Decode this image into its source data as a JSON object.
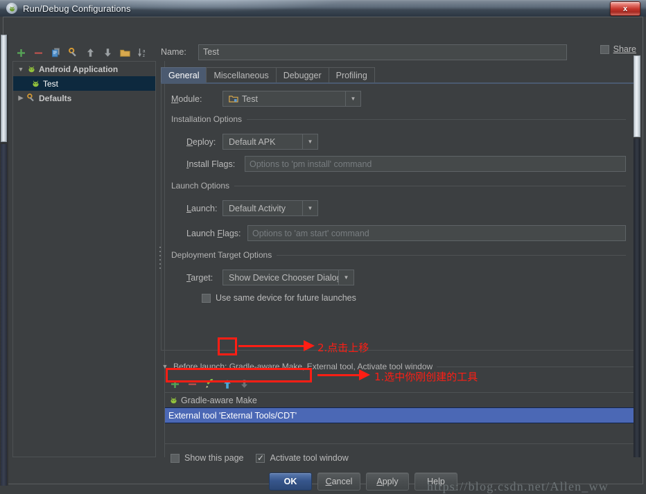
{
  "window": {
    "title": "Run/Debug Configurations",
    "icon": "android-studio-icon",
    "close_label": "x"
  },
  "sidebar": {
    "toolbar": [
      {
        "name": "add-configuration-button",
        "glyph": "+"
      },
      {
        "name": "remove-configuration-button",
        "glyph": "−"
      },
      {
        "name": "copy-configuration-button",
        "glyph": "copy-icon"
      },
      {
        "name": "edit-defaults-button",
        "glyph": "wrench-icon"
      },
      {
        "name": "move-up-button",
        "glyph": "↑"
      },
      {
        "name": "move-down-button",
        "glyph": "↓"
      },
      {
        "name": "create-folder-button",
        "glyph": "folder-icon"
      },
      {
        "name": "sort-configurations-button",
        "glyph": "sort-az-icon"
      }
    ],
    "tree": [
      {
        "label": "Android Application",
        "level": 0,
        "expanded": true,
        "icon": "android-icon",
        "selected": false,
        "bold": true
      },
      {
        "label": "Test",
        "level": 1,
        "expanded": null,
        "icon": "android-icon",
        "selected": true,
        "bold": false
      },
      {
        "label": "Defaults",
        "level": 0,
        "expanded": false,
        "icon": "wrench-icon",
        "selected": false,
        "bold": true
      }
    ]
  },
  "form": {
    "name_label": "Name:",
    "name_value": "Test",
    "share_label": "Share",
    "share_checked": false,
    "tabs": [
      {
        "label": "General",
        "active": true
      },
      {
        "label": "Miscellaneous",
        "active": false
      },
      {
        "label": "Debugger",
        "active": false
      },
      {
        "label": "Profiling",
        "active": false
      }
    ],
    "module_label": "Module:",
    "module_value": "Test",
    "installation_options_label": "Installation Options",
    "deploy_label": "Deploy:",
    "deploy_value": "Default APK",
    "install_flags_label": "Install Flags:",
    "install_flags_placeholder": "Options to 'pm install' command",
    "install_flags_value": "",
    "launch_options_label": "Launch Options",
    "launch_label": "Launch:",
    "launch_value": "Default Activity",
    "launch_flags_label": "Launch Flags:",
    "launch_flags_placeholder": "Options to 'am start' command",
    "launch_flags_value": "",
    "deployment_target_label": "Deployment Target Options",
    "target_label": "Target:",
    "target_value": "Show Device Chooser Dialog",
    "use_same_device_label": "Use same device for future launches",
    "use_same_device_checked": false
  },
  "before_launch": {
    "header": "Before launch: Gradle-aware Make, External tool, Activate tool window",
    "toolbar": [
      {
        "name": "add-task-button",
        "glyph": "+"
      },
      {
        "name": "remove-task-button",
        "glyph": "−"
      },
      {
        "name": "edit-task-button",
        "glyph": "pencil-icon"
      },
      {
        "name": "move-task-up-button",
        "glyph": "↑"
      },
      {
        "name": "move-task-down-button",
        "glyph": "↓"
      }
    ],
    "items": [
      {
        "label": "Gradle-aware Make",
        "icon": "android-icon",
        "selected": false
      },
      {
        "label": "External tool 'External Tools/CDT'",
        "icon": "",
        "selected": true
      }
    ],
    "show_this_page_label": "Show this page",
    "show_this_page_checked": false,
    "activate_tool_window_label": "Activate tool window",
    "activate_tool_window_checked": true
  },
  "buttons": {
    "ok": "OK",
    "cancel": "Cancel",
    "apply": "Apply",
    "help": "Help"
  },
  "annotations": [
    {
      "id": "step-2",
      "text": "2.点击上移"
    },
    {
      "id": "step-1",
      "text": "1.选中你刚创建的工具"
    }
  ],
  "watermark": "https://blog.csdn.net/Allen_ww",
  "colors": {
    "accent": "#4b5a70",
    "selection": "#4b68b5",
    "tree_selection": "#0d293e",
    "annotation": "#ff1e14",
    "background": "#3c3f41"
  }
}
